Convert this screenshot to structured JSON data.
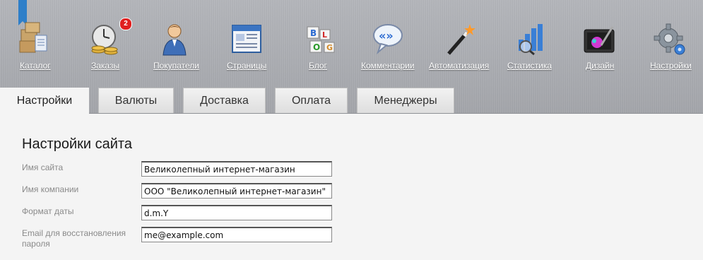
{
  "nav": {
    "items": [
      {
        "label": "Каталог",
        "icon": "catalog-boxes-icon"
      },
      {
        "label": "Заказы",
        "icon": "orders-clock-coins-icon",
        "badge": "2"
      },
      {
        "label": "Покупатели",
        "icon": "customer-person-icon"
      },
      {
        "label": "Страницы",
        "icon": "pages-window-icon"
      },
      {
        "label": "Блог",
        "icon": "blog-blocks-icon"
      },
      {
        "label": "Комментарии",
        "icon": "comments-bubble-icon"
      },
      {
        "label": "Автоматизация",
        "icon": "automation-wand-icon"
      },
      {
        "label": "Статистика",
        "icon": "statistics-chart-icon"
      },
      {
        "label": "Дизайн",
        "icon": "design-palette-icon"
      },
      {
        "label": "Настройки",
        "icon": "settings-gear-icon"
      }
    ]
  },
  "tabs": [
    {
      "label": "Настройки",
      "active": true
    },
    {
      "label": "Валюты",
      "active": false
    },
    {
      "label": "Доставка",
      "active": false
    },
    {
      "label": "Оплата",
      "active": false
    },
    {
      "label": "Менеджеры",
      "active": false
    }
  ],
  "form": {
    "title": "Настройки сайта",
    "fields": [
      {
        "label": "Имя сайта",
        "value": "Великолепный интернет-магазин"
      },
      {
        "label": "Имя компании",
        "value": "ООО \"Великолепный интернет-магазин\""
      },
      {
        "label": "Формат даты",
        "value": "d.m.Y"
      },
      {
        "label": "Email для восстановления пароля",
        "value": "me@example.com"
      }
    ]
  },
  "colors": {
    "header_bg": "#a9abb0",
    "badge": "#e02020",
    "bookmark": "#2e7fc9"
  }
}
